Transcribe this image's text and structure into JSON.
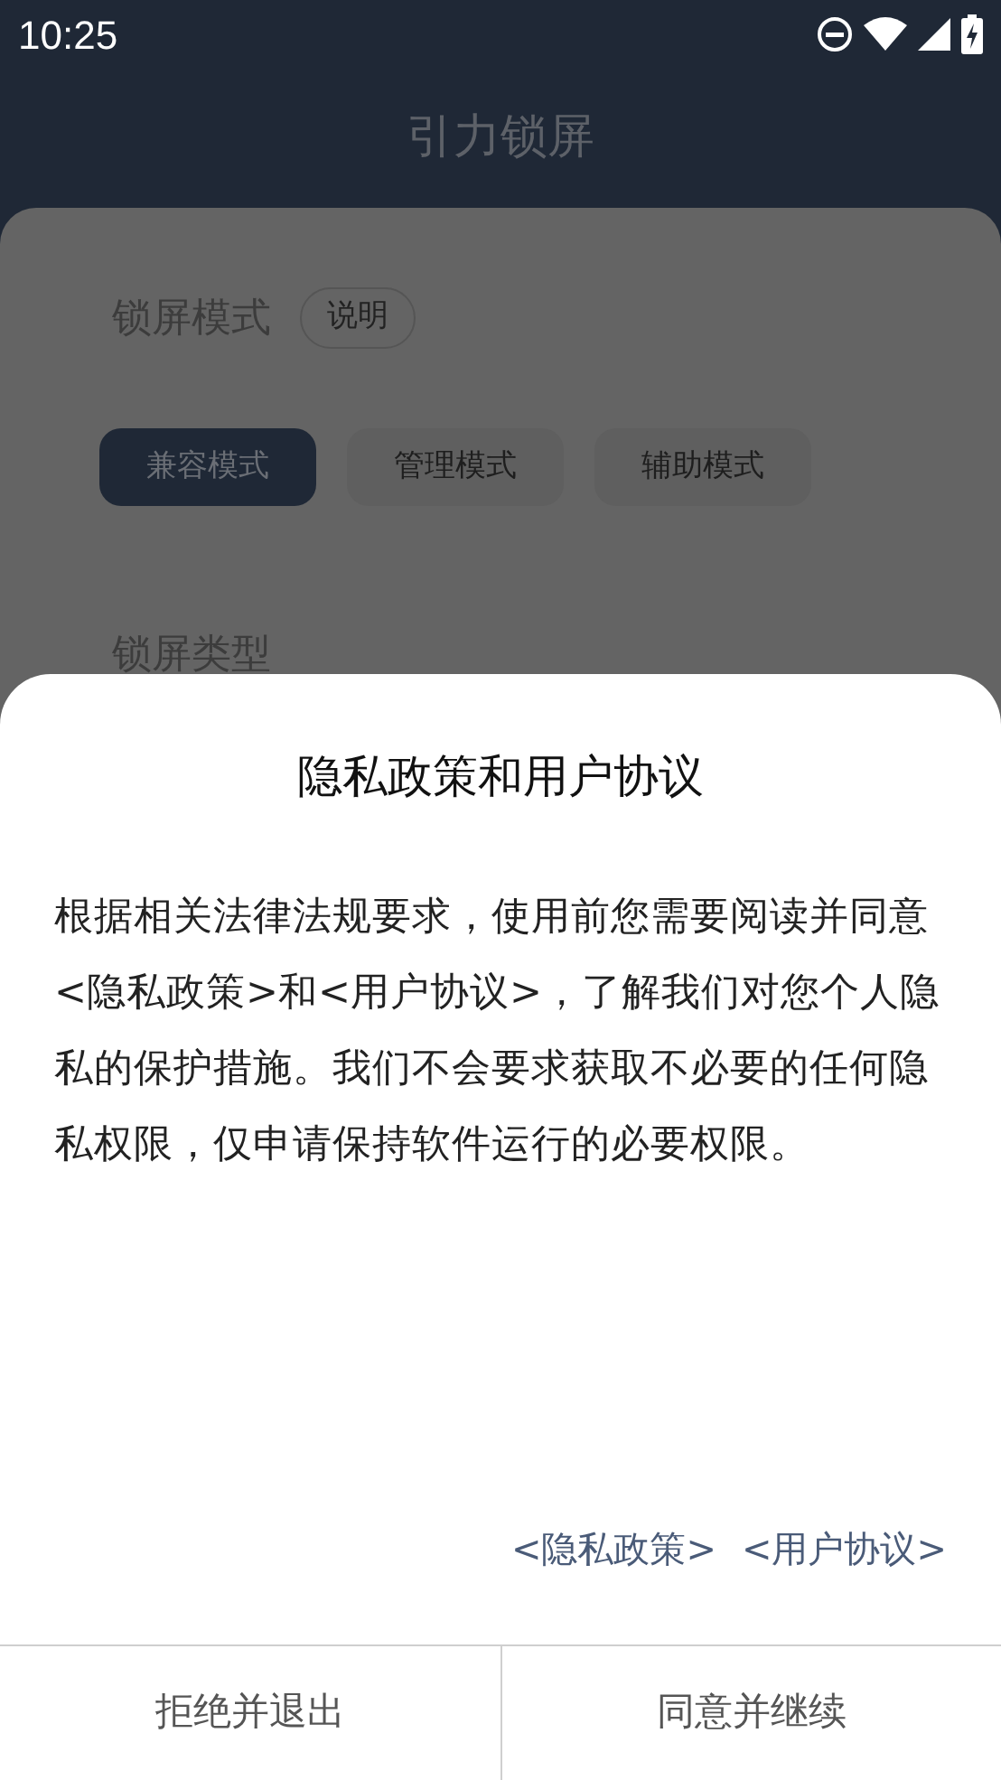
{
  "status_bar": {
    "time": "10:25"
  },
  "header": {
    "title": "引力锁屏"
  },
  "lock_mode": {
    "label": "锁屏模式",
    "help_button": "说明",
    "modes": [
      {
        "label": "兼容模式",
        "selected": true
      },
      {
        "label": "管理模式",
        "selected": false
      },
      {
        "label": "辅助模式",
        "selected": false
      }
    ]
  },
  "lock_type": {
    "label": "锁屏类型"
  },
  "dialog": {
    "title": "隐私政策和用户协议",
    "body": "根据相关法律法规要求，使用前您需要阅读并同意<隐私政策>和<用户协议>，了解我们对您个人隐私的保护措施。我们不会要求获取不必要的任何隐私权限，仅申请保持软件运行的必要权限。",
    "links": [
      "<隐私政策>",
      "<用户协议>"
    ],
    "buttons": [
      "拒绝并退出",
      "同意并继续"
    ]
  }
}
